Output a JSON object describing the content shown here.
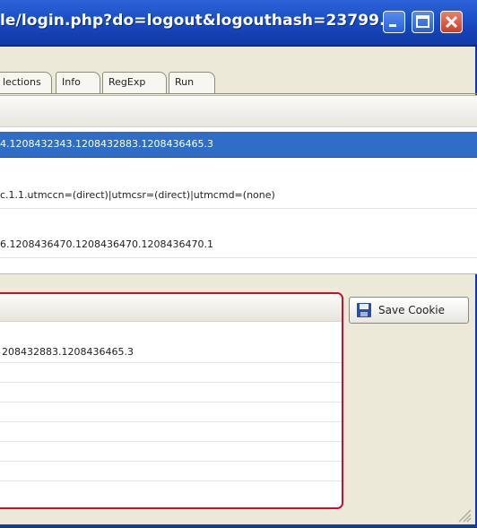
{
  "window": {
    "title": "le/login.php?do=logout&logouthash=23799...",
    "controls": {
      "minimize": "minimize",
      "maximize": "maximize",
      "close": "close"
    },
    "colors": {
      "titlebar": "#1c4fc6",
      "selection": "#2f6dc6",
      "highlight_border": "#c8102e"
    }
  },
  "tabs": [
    {
      "label": "lections"
    },
    {
      "label": "Info"
    },
    {
      "label": "RegExp"
    },
    {
      "label": "Run"
    }
  ],
  "cookies": [
    {
      "value": "4.1208432343.1208432883.1208436465.3",
      "selected": true
    },
    {
      "value": "c.1.1.utmccn=(direct)|utmcsr=(direct)|utmcmd=(none)",
      "selected": false
    },
    {
      "value": "6.1208436470.1208436470.1208436470.1",
      "selected": false
    }
  ],
  "editor": {
    "value": "208432883.1208436465.3"
  },
  "save_button": {
    "label": "Save Cookie",
    "icon": "floppy-disk-icon"
  }
}
